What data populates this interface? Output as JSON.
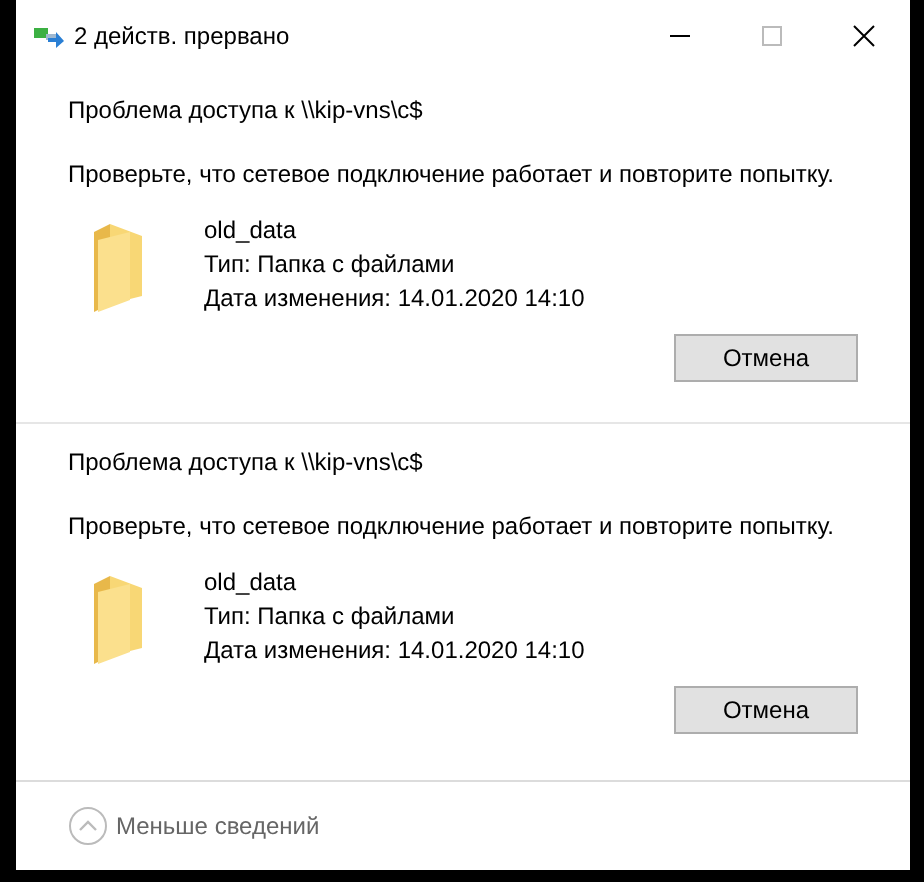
{
  "window": {
    "title": "2 действ. прервано"
  },
  "errors": [
    {
      "heading": "Проблема доступа к \\\\kip-vns\\c$",
      "message": "Проверьте, что сетевое подключение работает и повторите попытку.",
      "file_name": "old_data",
      "file_type": "Тип: Папка с файлами",
      "modified": "Дата изменения: 14.01.2020 14:10",
      "button": "Отмена"
    },
    {
      "heading": "Проблема доступа к \\\\kip-vns\\c$",
      "message": "Проверьте, что сетевое подключение работает и повторите попытку.",
      "file_name": "old_data",
      "file_type": "Тип: Папка с файлами",
      "modified": "Дата изменения: 14.01.2020 14:10",
      "button": "Отмена"
    }
  ],
  "footer": {
    "toggle": "Меньше сведений",
    "expanded": true
  }
}
